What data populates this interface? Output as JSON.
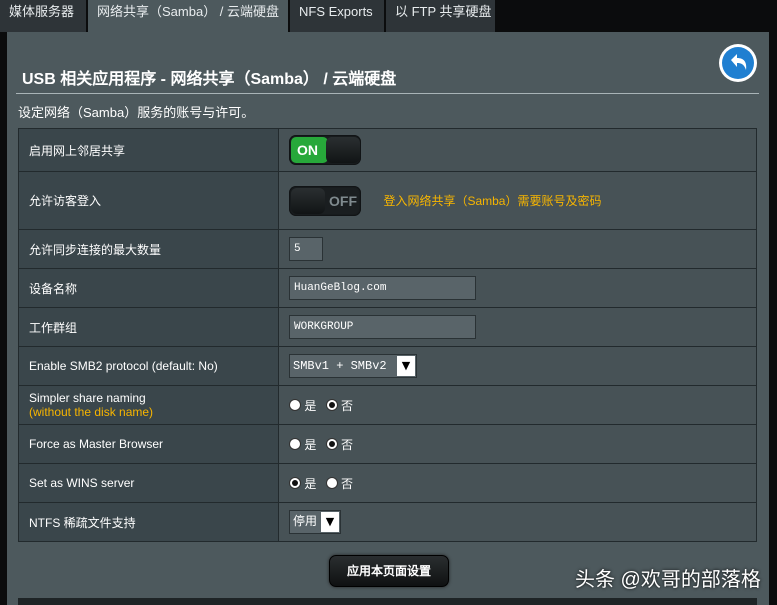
{
  "tabs": [
    {
      "label": "媒体服务器"
    },
    {
      "label": "网络共享（Samba） / 云端硬盘"
    },
    {
      "label": "NFS Exports"
    },
    {
      "label": "以 FTP 共享硬盘"
    }
  ],
  "page": {
    "title": "USB 相关应用程序 - 网络共享（Samba） / 云端硬盘",
    "description": "设定网络（Samba）服务的账号与许可。",
    "back_icon": "back-arrow-icon"
  },
  "form": {
    "neighbor_share": {
      "label": "启用网上邻居共享",
      "state": "ON"
    },
    "guest_login": {
      "label": "允许访客登入",
      "state": "OFF",
      "hint": "登入网络共享（Samba）需要账号及密码"
    },
    "max_connections": {
      "label": "允许同步连接的最大数量",
      "value": "5"
    },
    "device_name": {
      "label": "设备名称",
      "value": "HuanGeBlog.com"
    },
    "workgroup": {
      "label": "工作群组",
      "value": "WORKGROUP"
    },
    "smb2": {
      "label": "Enable SMB2 protocol (default: No)",
      "value": "SMBv1 + SMBv2"
    },
    "simpler_share": {
      "label": "Simpler share naming",
      "sublabel": "(without the disk name)",
      "yes": "是",
      "no": "否",
      "selected": "no"
    },
    "master_browser": {
      "label": "Force as Master Browser",
      "yes": "是",
      "no": "否",
      "selected": "no"
    },
    "wins_server": {
      "label": "Set as WINS server",
      "yes": "是",
      "no": "否",
      "selected": "yes"
    },
    "ntfs_sparse": {
      "label": "NTFS 稀疏文件支持",
      "value": "停用"
    }
  },
  "apply_button": "应用本页面设置",
  "watermark": "头条 @欢哥的部落格",
  "colors": {
    "accent_on": "#27a83a",
    "hint": "#f7b500",
    "panel": "#4d595d"
  }
}
